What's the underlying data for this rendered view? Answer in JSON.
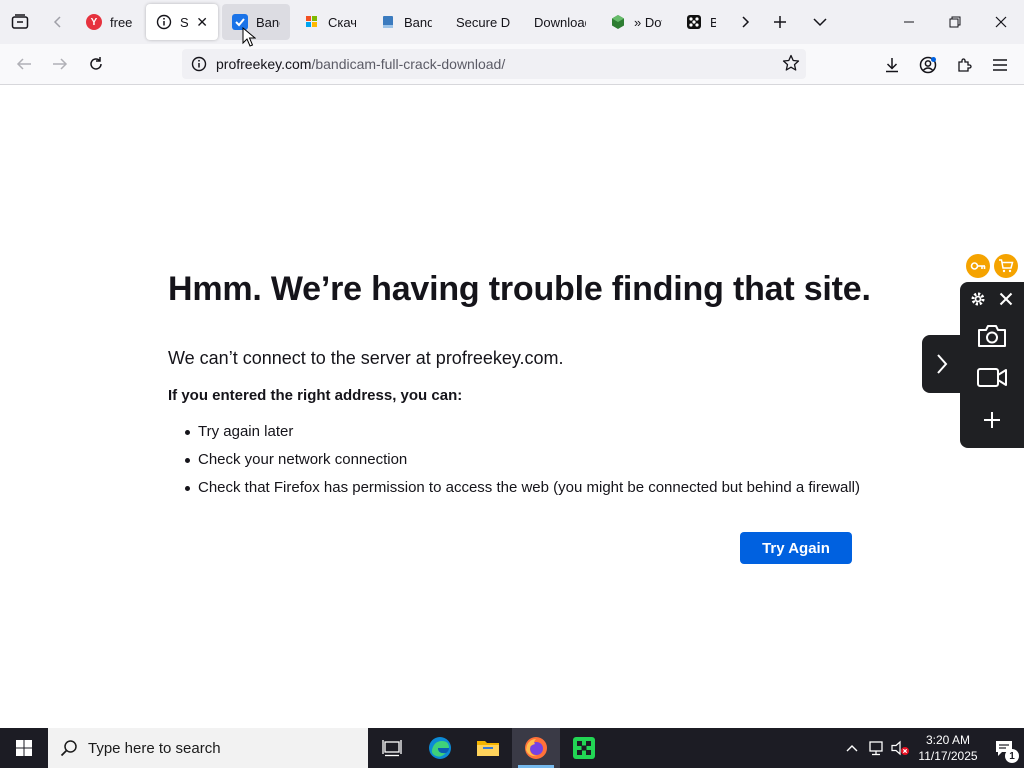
{
  "browser": {
    "tabs": [
      {
        "label": "free b",
        "favicon_letter": "Y",
        "favicon_color": "#e6323e"
      },
      {
        "label": "Ser",
        "active": true
      },
      {
        "label": "Bandi",
        "favicon_color": "#1a73e8"
      },
      {
        "label": "Скача"
      },
      {
        "label": "Bandi"
      },
      {
        "label": "Secure Do"
      },
      {
        "label": "Download"
      },
      {
        "label": "» Dow"
      },
      {
        "label": "Bar"
      }
    ],
    "url": {
      "domain": "profreekey.com",
      "path": "/bandicam-full-crack-download/"
    }
  },
  "error_page": {
    "title": "Hmm. We’re having trouble finding that site.",
    "description": "We can’t connect to the server at profreekey.com.",
    "subtitle": "If you entered the right address, you can:",
    "suggestions": [
      "Try again later",
      "Check your network connection",
      "Check that Firefox has permission to access the web (you might be connected but behind a firewall)"
    ],
    "try_again_label": "Try Again"
  },
  "taskbar": {
    "search_placeholder": "Type here to search",
    "time": "3:20 AM",
    "date": "11/17/2025",
    "notification_count": "1"
  },
  "colors": {
    "accent_blue": "#0061e0",
    "capture_panel": "#1f2023",
    "badge_orange": "#f5a300"
  }
}
